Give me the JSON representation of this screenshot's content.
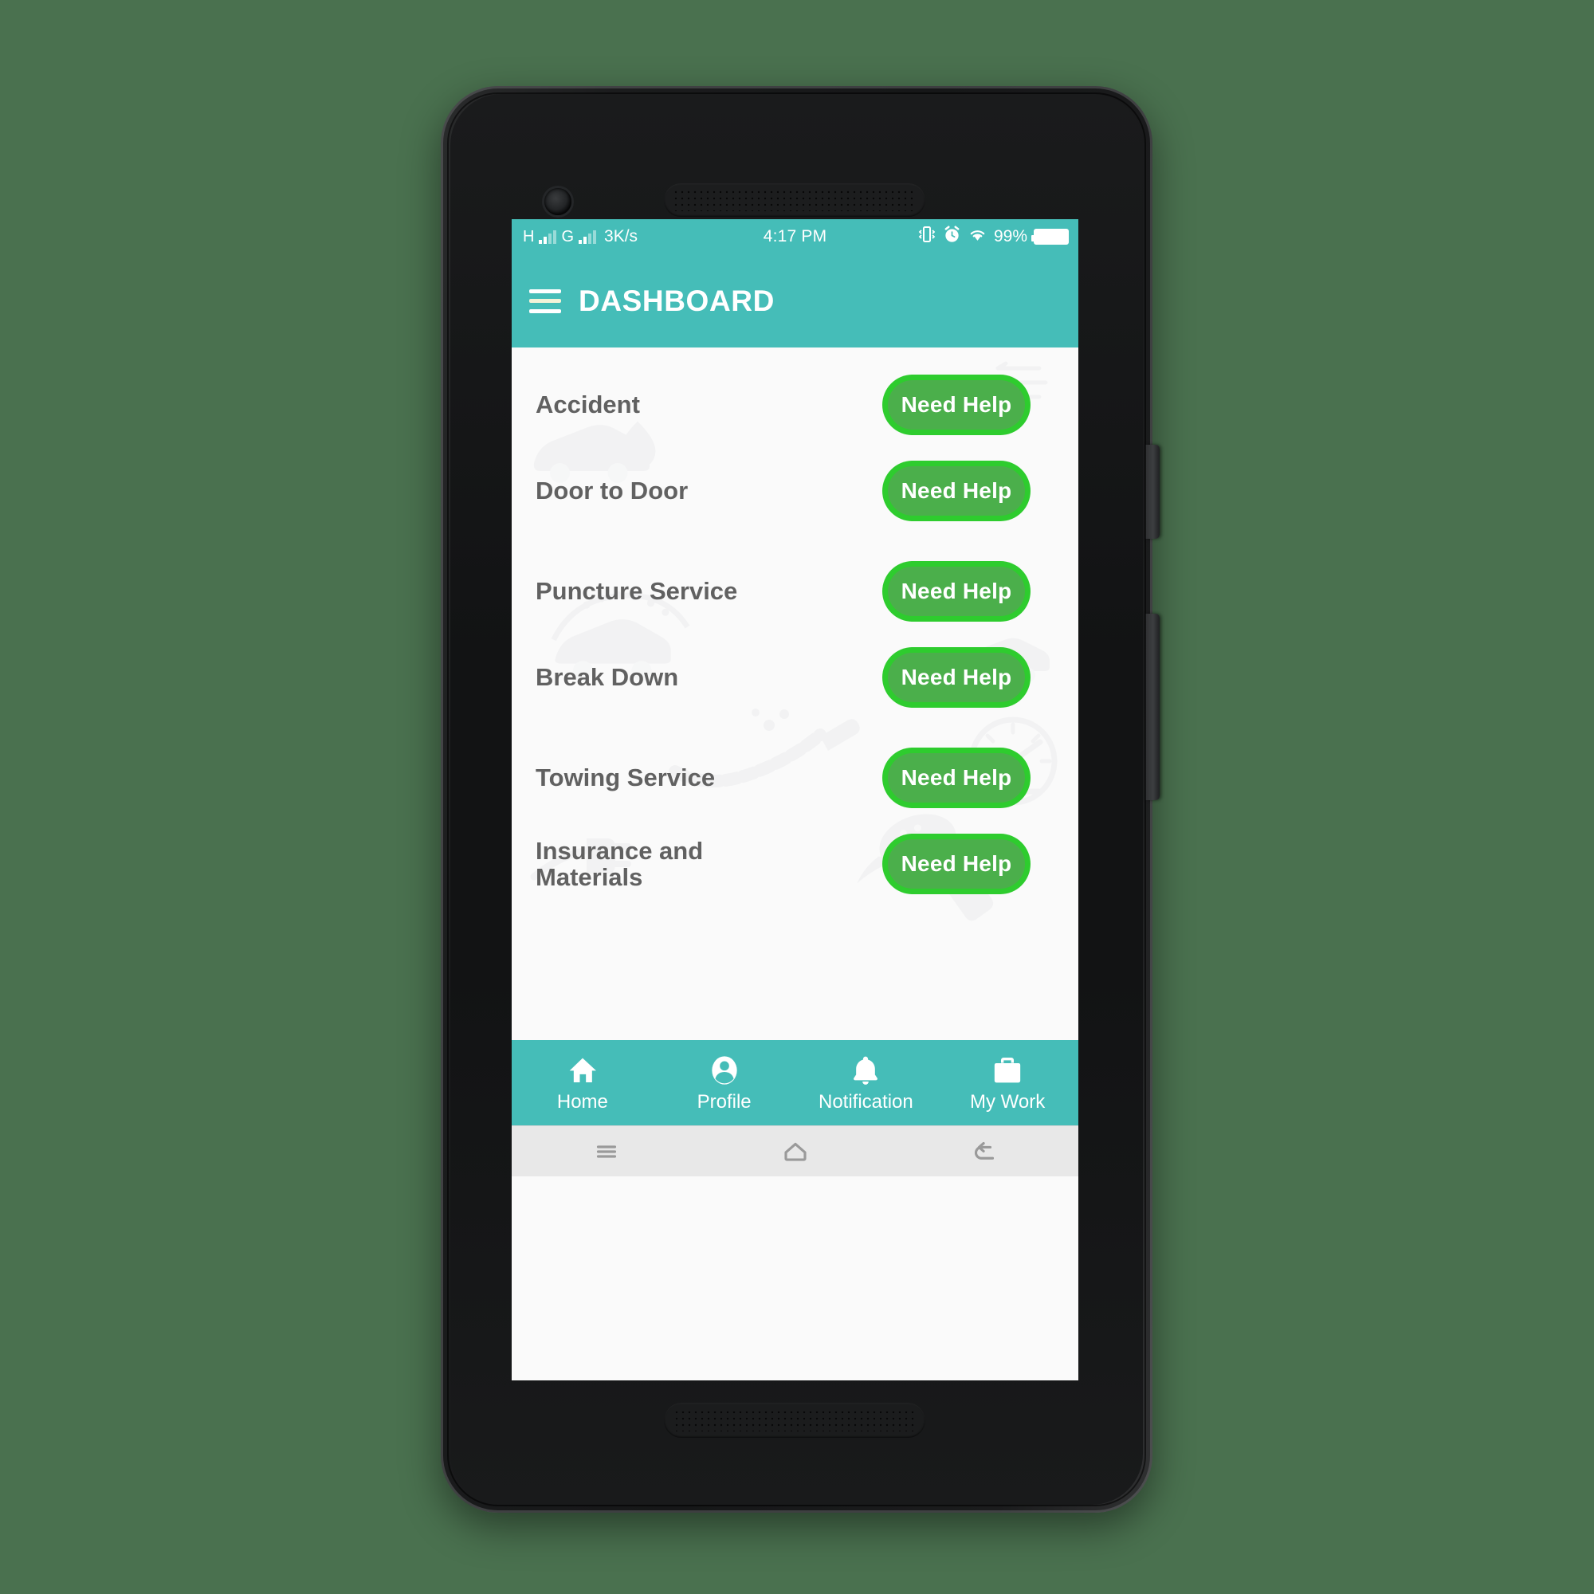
{
  "device": {
    "camera_icon": "front-camera-icon",
    "earpiece_icon": "earpiece-speaker-grille",
    "bottom_speaker_icon": "bottom-speaker-grille",
    "power_button": "power-button",
    "volume_button": "volume-rocker-button"
  },
  "status_bar": {
    "network_type_1": "H",
    "network_type_2": "G",
    "data_speed": "3K/s",
    "time": "4:17 PM",
    "battery_percent": "99%",
    "icons": {
      "vibrate": "vibrate-icon",
      "alarm": "alarm-clock-icon",
      "wifi": "wifi-icon",
      "battery": "battery-icon"
    },
    "background_color": "#45BDB8"
  },
  "app_bar": {
    "menu_icon": "hamburger-menu-icon",
    "title": "DASHBOARD",
    "background_color": "#45BDB8",
    "text_color": "#FFFFFF"
  },
  "services": {
    "button_label": "Need Help",
    "button_outer_color": "#2ECC2E",
    "button_inner_color": "#4BAF4B",
    "label_color": "#616161",
    "items": [
      {
        "label": "Accident"
      },
      {
        "label": "Door to Door"
      },
      {
        "label": "Puncture Service"
      },
      {
        "label": "Break Down"
      },
      {
        "label": "Towing Service"
      },
      {
        "label": "Insurance and Materials"
      }
    ]
  },
  "bottom_nav": {
    "background_color": "#45BDB8",
    "items": [
      {
        "label": "Home",
        "icon": "home-icon"
      },
      {
        "label": "Profile",
        "icon": "person-icon"
      },
      {
        "label": "Notification",
        "icon": "bell-icon"
      },
      {
        "label": "My Work",
        "icon": "briefcase-icon"
      }
    ]
  },
  "system_nav": {
    "background_color": "#E8E8E8",
    "items": [
      {
        "icon": "recents-icon"
      },
      {
        "icon": "home-outline-icon"
      },
      {
        "icon": "back-icon"
      }
    ]
  },
  "page_background_color": "#4A714F"
}
